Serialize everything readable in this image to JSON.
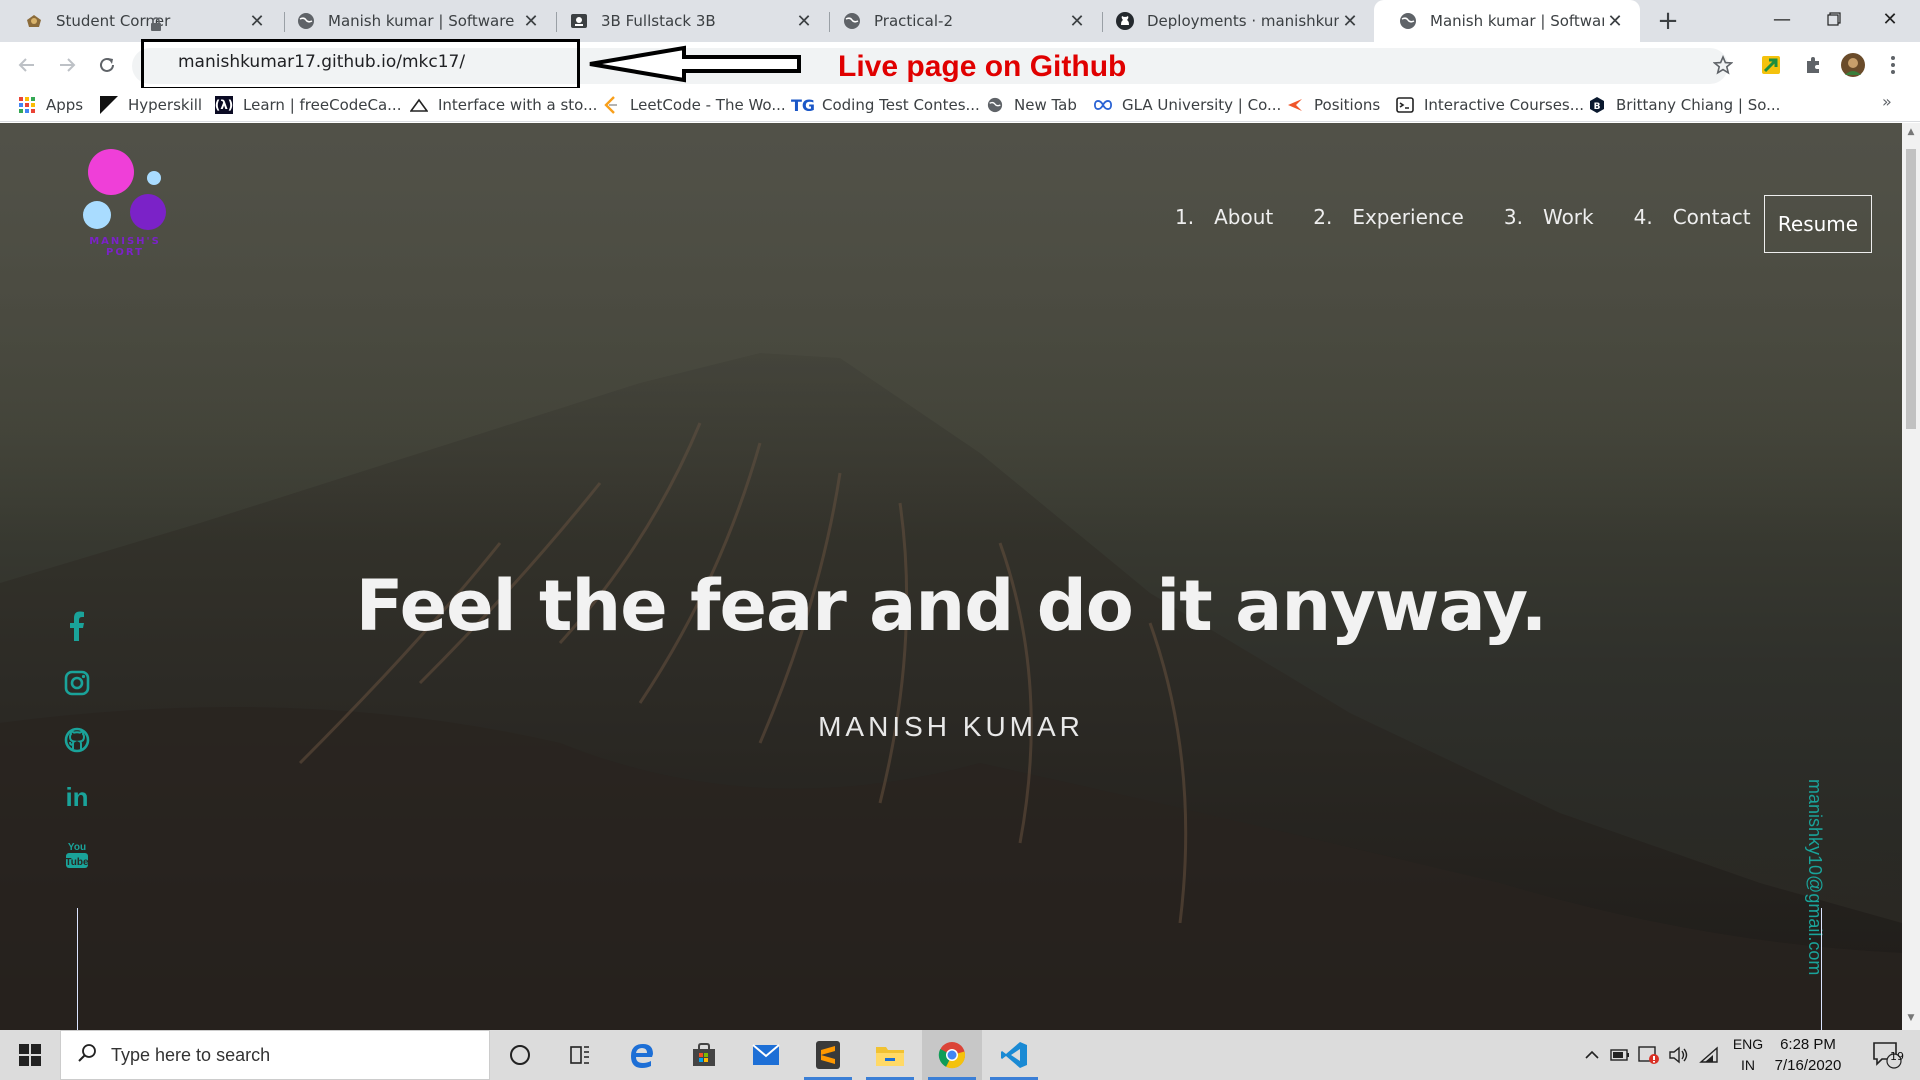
{
  "browser": {
    "tabs": [
      {
        "title": "Student Corner",
        "icon": "student-corner-icon",
        "active": false
      },
      {
        "title": "Manish kumar | Software Eng",
        "icon": "globe-icon",
        "active": false
      },
      {
        "title": "3B Fullstack 3B",
        "icon": "classroom-icon",
        "active": false
      },
      {
        "title": "Practical-2",
        "icon": "globe-icon",
        "active": false
      },
      {
        "title": "Deployments · manishkumar",
        "icon": "github-icon",
        "active": false
      },
      {
        "title": "Manish kumar | Software Eng",
        "icon": "globe-icon",
        "active": true
      }
    ],
    "url": "manishkumar17.github.io/mkc17/",
    "annotation": "Live page on Github",
    "bookmarks": [
      {
        "label": "Apps"
      },
      {
        "label": "Hyperskill"
      },
      {
        "label": "Learn | freeCodeCa..."
      },
      {
        "label": "Interface with a sto..."
      },
      {
        "label": "LeetCode - The Wo..."
      },
      {
        "label": "Coding Test Contes..."
      },
      {
        "label": "New Tab"
      },
      {
        "label": "GLA University | Co..."
      },
      {
        "label": "Positions"
      },
      {
        "label": "Interactive Courses..."
      },
      {
        "label": "Brittany Chiang | So..."
      }
    ]
  },
  "site": {
    "logo_text": "MANISH'S PORT",
    "nav": [
      {
        "num": "1.",
        "label": "About"
      },
      {
        "num": "2.",
        "label": "Experience"
      },
      {
        "num": "3.",
        "label": "Work"
      },
      {
        "num": "4.",
        "label": "Contact"
      }
    ],
    "resume_label": "Resume",
    "quote": "Feel the fear and do it anyway.",
    "name": "MANISH KUMAR",
    "email": "manishky10@gmail.com",
    "socials": [
      "facebook-icon",
      "instagram-icon",
      "github-icon",
      "linkedin-icon",
      "youtube-icon"
    ]
  },
  "taskbar": {
    "search_placeholder": "Type here to search",
    "lang_line1": "ENG",
    "lang_line2": "IN",
    "time": "6:28 PM",
    "date": "7/16/2020",
    "notification_count": "19"
  },
  "colors": {
    "accent": "#1aa39a",
    "annotation": "#e00000",
    "logo_pink": "#ef3fd8",
    "logo_purple": "#7b22c8"
  }
}
